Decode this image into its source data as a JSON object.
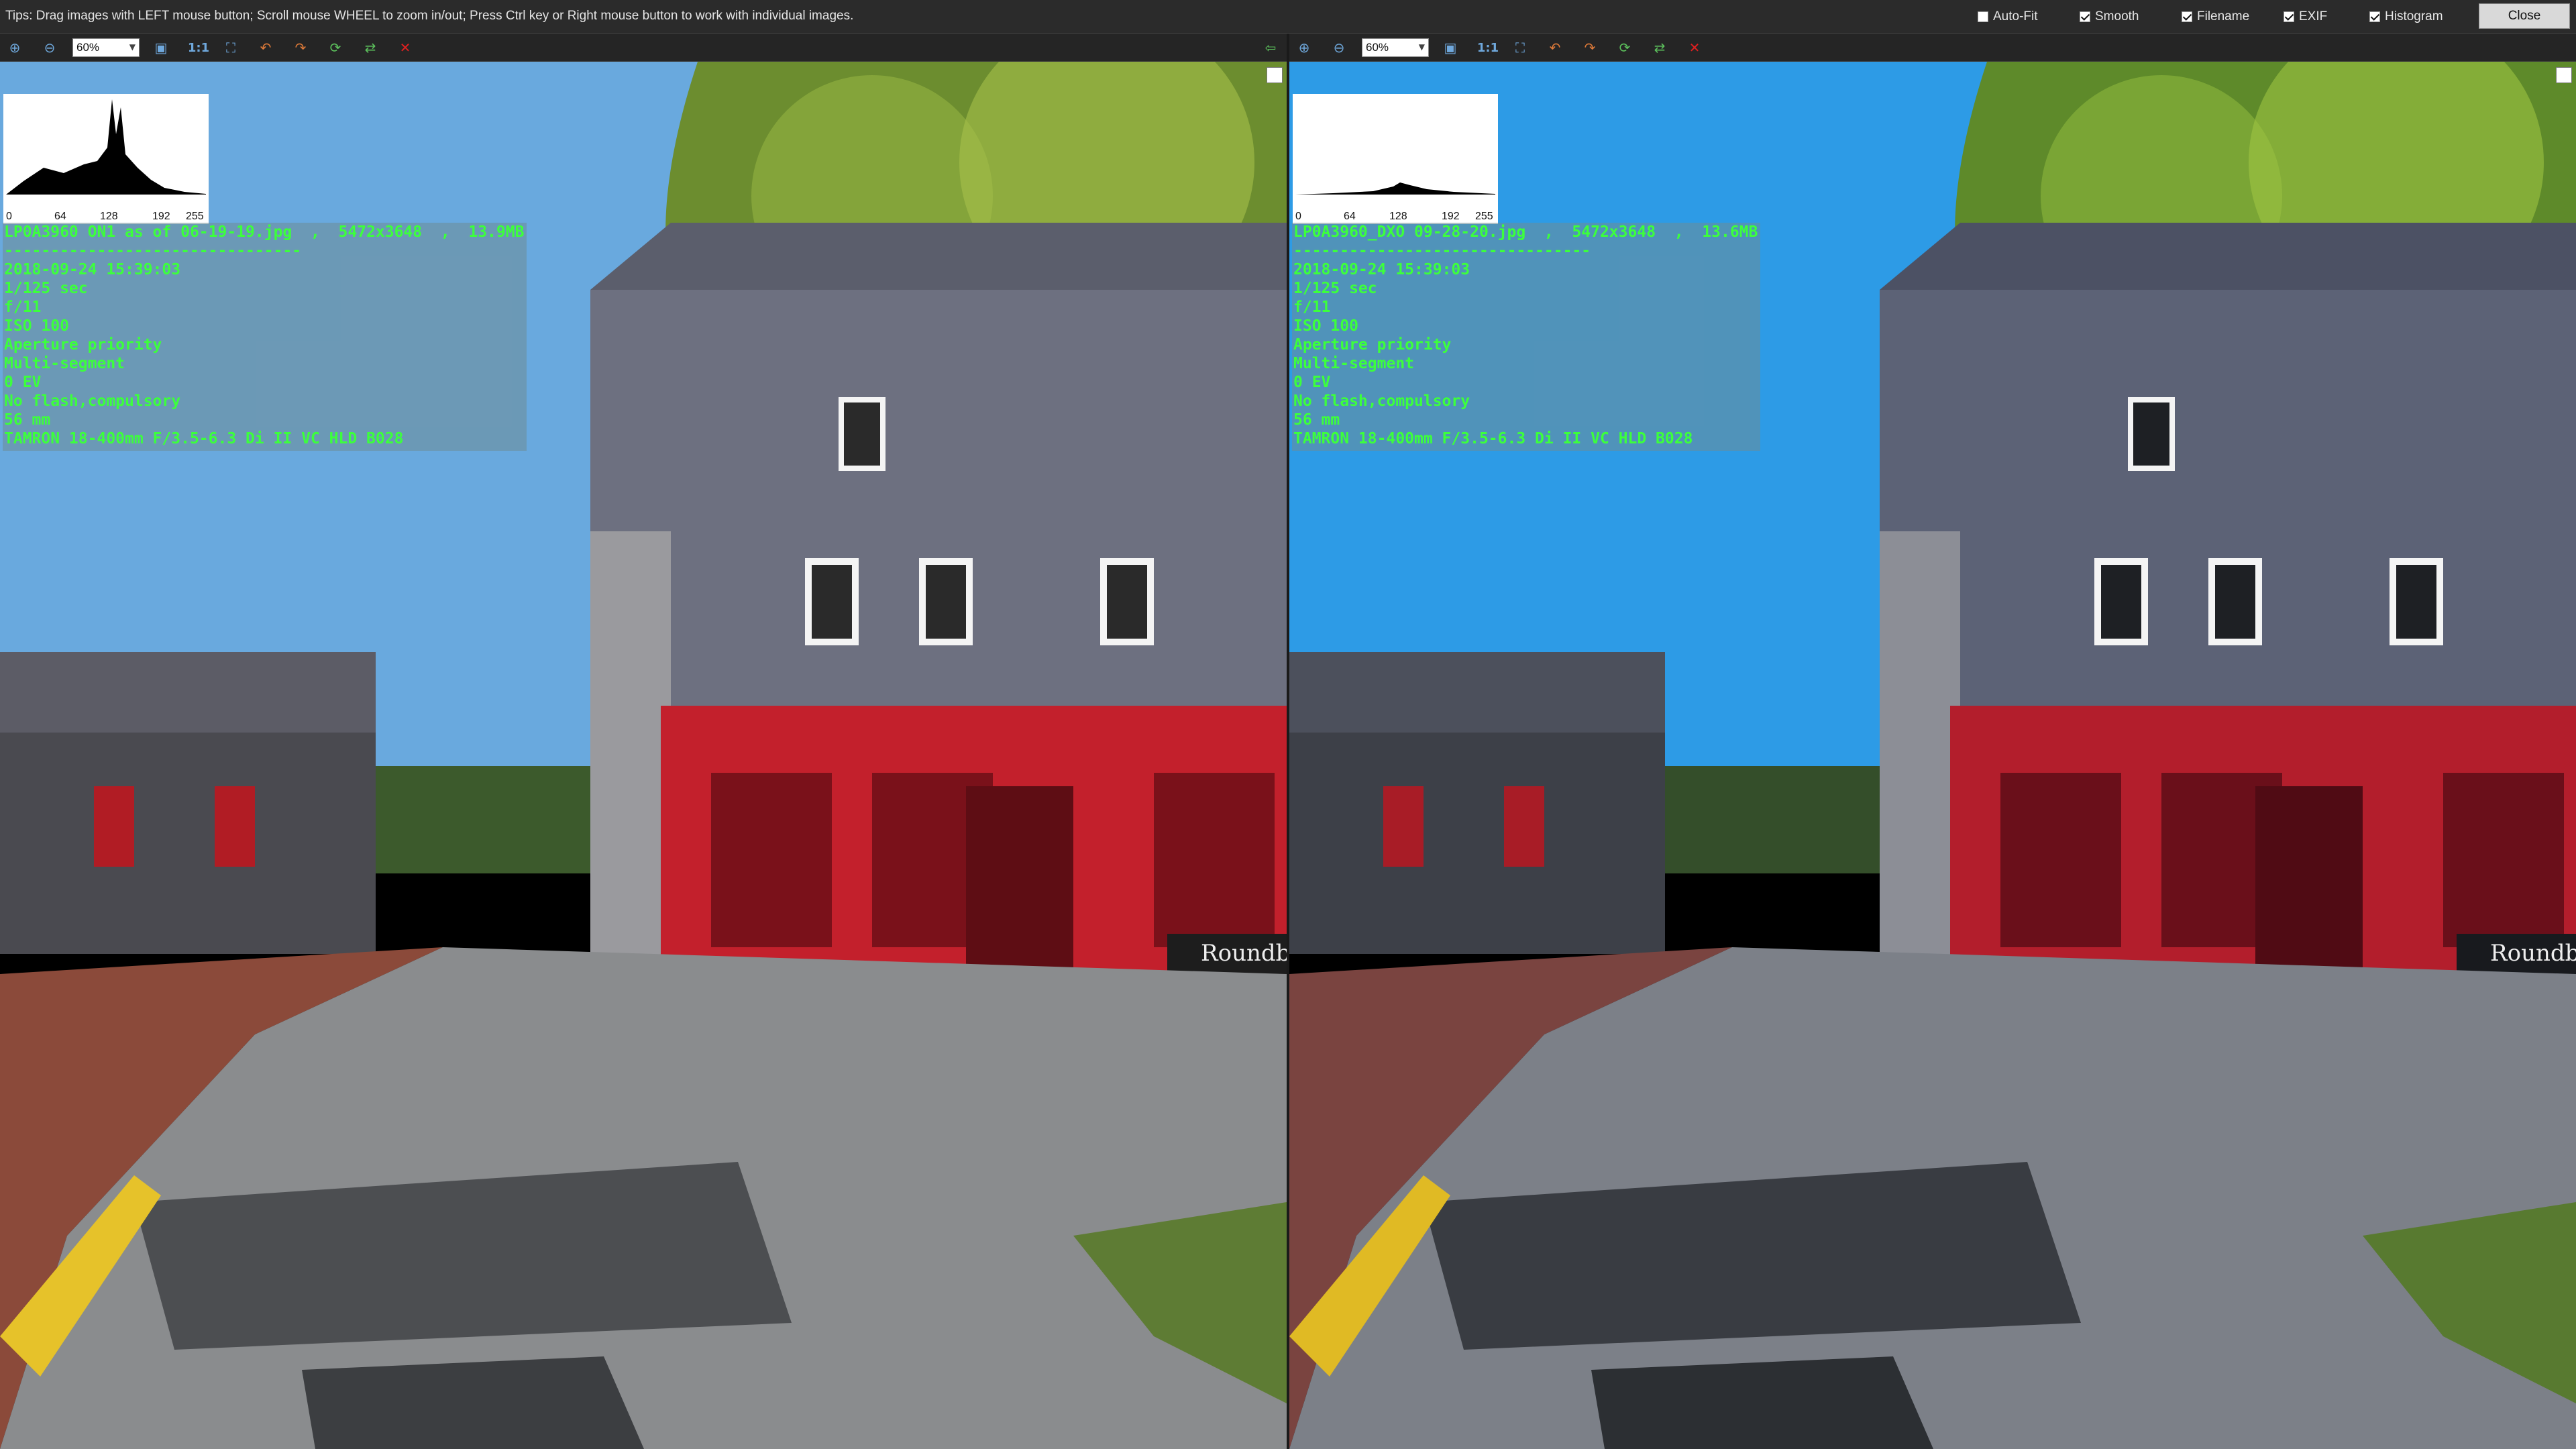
{
  "topbar": {
    "tips": "Tips: Drag images with LEFT mouse button; Scroll mouse WHEEL to zoom in/out; Press Ctrl key or Right mouse button to work with individual images.",
    "options": [
      {
        "label": "Auto-Fit",
        "checked": false
      },
      {
        "label": "Smooth",
        "checked": true
      },
      {
        "label": "Filename",
        "checked": true
      },
      {
        "label": "EXIF",
        "checked": true
      },
      {
        "label": "Histogram",
        "checked": true
      }
    ],
    "close_label": "Close"
  },
  "panels": [
    {
      "zoom": "60%",
      "one_to_one": "1:1",
      "histogram": {
        "ticks": [
          "0",
          "64",
          "128",
          "192",
          "255"
        ]
      },
      "filename_line": "LP0A3960 ON1 as of 06-19-19.jpg  ,  5472x3648  ,  13.9MB",
      "separator": "--------------------------------",
      "exif": [
        "2018-09-24 15:39:03",
        "1/125 sec",
        "f/11",
        "ISO 100",
        "Aperture priority",
        "Multi-segment",
        "0 EV",
        "No flash,compulsory",
        "56 mm",
        "TAMRON 18-400mm F/3.5-6.3 Di II VC HLD B028"
      ],
      "sign_text": "Roundbird"
    },
    {
      "zoom": "60%",
      "one_to_one": "1:1",
      "histogram": {
        "ticks": [
          "0",
          "64",
          "128",
          "192",
          "255"
        ]
      },
      "filename_line": "LP0A3960_DXO 09-28-20.jpg  ,  5472x3648  ,  13.6MB",
      "separator": "--------------------------------",
      "exif": [
        "2018-09-24 15:39:03",
        "1/125 sec",
        "f/11",
        "ISO 100",
        "Aperture priority",
        "Multi-segment",
        "0 EV",
        "No flash,compulsory",
        "56 mm",
        "TAMRON 18-400mm F/3.5-6.3 Di II VC HLD B028"
      ],
      "sign_text": "Roundbird"
    }
  ],
  "colors": {
    "exif_text": "#3cff3c",
    "toolbar_icon": "#6fa8dc",
    "left_sky": "#69a9de",
    "right_sky": "#2d9be6",
    "storefront_red": "#c3202c"
  },
  "icons": [
    "zoom-in-icon",
    "zoom-out-icon",
    "fit-icon",
    "actual-size-icon",
    "fullscreen-icon",
    "rotate-left-icon",
    "rotate-right-icon",
    "sync-icon",
    "swap-icon",
    "close-icon",
    "pin-icon"
  ]
}
